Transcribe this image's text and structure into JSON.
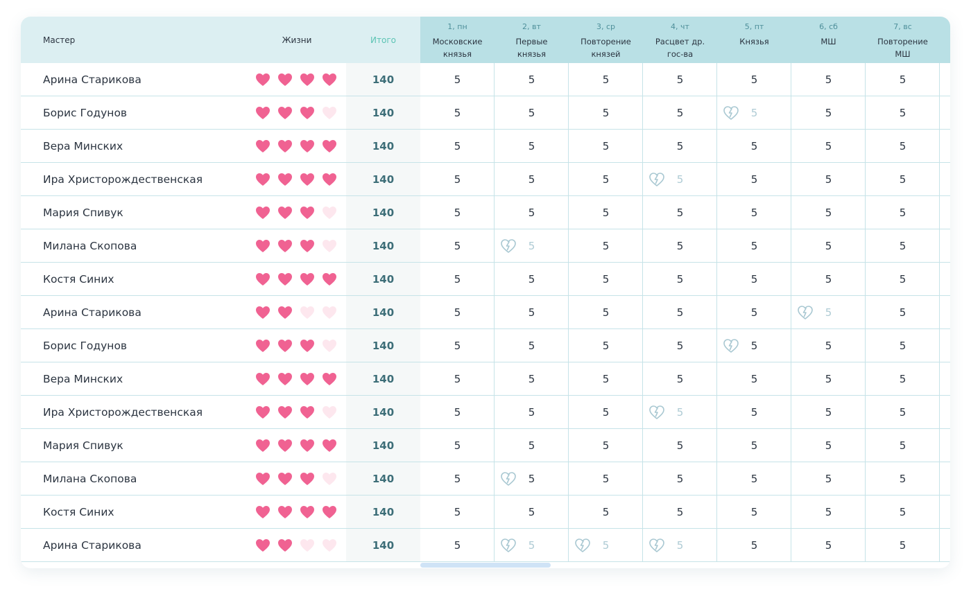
{
  "table": {
    "headers": {
      "master": "Мастер",
      "lives": "Жизни",
      "total": "Итого"
    },
    "days": [
      {
        "num": "1, пн",
        "title": "Московские князья"
      },
      {
        "num": "2, вт",
        "title": "Первые князья"
      },
      {
        "num": "3, ср",
        "title": "Повторение князей"
      },
      {
        "num": "4, чт",
        "title": "Расцвет др. гос-ва"
      },
      {
        "num": "5, пт",
        "title": "Князья"
      },
      {
        "num": "6, сб",
        "title": "МШ"
      },
      {
        "num": "7, вс",
        "title": "Повторение МШ"
      }
    ],
    "rows": [
      {
        "name": "Арина Старикова",
        "lives": 4,
        "total": "140",
        "scores": [
          "5",
          "5",
          "5",
          "5",
          "5",
          "5",
          "5"
        ],
        "broken": [],
        "faded": []
      },
      {
        "name": "Борис Годунов",
        "lives": 3,
        "total": "140",
        "scores": [
          "5",
          "5",
          "5",
          "5",
          "5",
          "5",
          "5"
        ],
        "broken": [
          4
        ],
        "faded": [
          4
        ]
      },
      {
        "name": "Вера Минских",
        "lives": 4,
        "total": "140",
        "scores": [
          "5",
          "5",
          "5",
          "5",
          "5",
          "5",
          "5"
        ],
        "broken": [],
        "faded": []
      },
      {
        "name": "Ира Христорождественская",
        "lives": 4,
        "total": "140",
        "scores": [
          "5",
          "5",
          "5",
          "5",
          "5",
          "5",
          "5"
        ],
        "broken": [
          3
        ],
        "faded": [
          3
        ]
      },
      {
        "name": "Мария Спивук",
        "lives": 3,
        "total": "140",
        "scores": [
          "5",
          "5",
          "5",
          "5",
          "5",
          "5",
          "5"
        ],
        "broken": [],
        "faded": []
      },
      {
        "name": "Милана Скопова",
        "lives": 3,
        "total": "140",
        "scores": [
          "5",
          "5",
          "5",
          "5",
          "5",
          "5",
          "5"
        ],
        "broken": [
          1
        ],
        "faded": [
          1
        ]
      },
      {
        "name": "Костя Синих",
        "lives": 4,
        "total": "140",
        "scores": [
          "5",
          "5",
          "5",
          "5",
          "5",
          "5",
          "5"
        ],
        "broken": [],
        "faded": []
      },
      {
        "name": "Арина Старикова",
        "lives": 2,
        "total": "140",
        "scores": [
          "5",
          "5",
          "5",
          "5",
          "5",
          "5",
          "5"
        ],
        "broken": [
          5
        ],
        "faded": [
          5
        ]
      },
      {
        "name": "Борис Годунов",
        "lives": 3,
        "total": "140",
        "scores": [
          "5",
          "5",
          "5",
          "5",
          "5",
          "5",
          "5"
        ],
        "broken": [
          4
        ],
        "faded": []
      },
      {
        "name": "Вера Минских",
        "lives": 4,
        "total": "140",
        "scores": [
          "5",
          "5",
          "5",
          "5",
          "5",
          "5",
          "5"
        ],
        "broken": [],
        "faded": []
      },
      {
        "name": "Ира Христорождественская",
        "lives": 3,
        "total": "140",
        "scores": [
          "5",
          "5",
          "5",
          "5",
          "5",
          "5",
          "5"
        ],
        "broken": [
          3
        ],
        "faded": [
          3
        ]
      },
      {
        "name": "Мария Спивук",
        "lives": 4,
        "total": "140",
        "scores": [
          "5",
          "5",
          "5",
          "5",
          "5",
          "5",
          "5"
        ],
        "broken": [],
        "faded": []
      },
      {
        "name": "Милана Скопова",
        "lives": 3,
        "total": "140",
        "scores": [
          "5",
          "5",
          "5",
          "5",
          "5",
          "5",
          "5"
        ],
        "broken": [
          1
        ],
        "faded": []
      },
      {
        "name": "Костя Синих",
        "lives": 4,
        "total": "140",
        "scores": [
          "5",
          "5",
          "5",
          "5",
          "5",
          "5",
          "5"
        ],
        "broken": [],
        "faded": []
      },
      {
        "name": "Арина Старикова",
        "lives": 2,
        "total": "140",
        "scores": [
          "5",
          "5",
          "5",
          "5",
          "5",
          "5",
          "5"
        ],
        "broken": [
          1,
          2,
          3
        ],
        "faded": [
          1,
          2,
          3
        ]
      }
    ],
    "max_lives": 4
  },
  "colors": {
    "heart_full": "#f06292",
    "heart_empty": "#fde7ee",
    "broken_heart": "#a9c8d2"
  },
  "icons": {
    "heart": "heart-icon",
    "broken_heart": "broken-heart-icon"
  }
}
